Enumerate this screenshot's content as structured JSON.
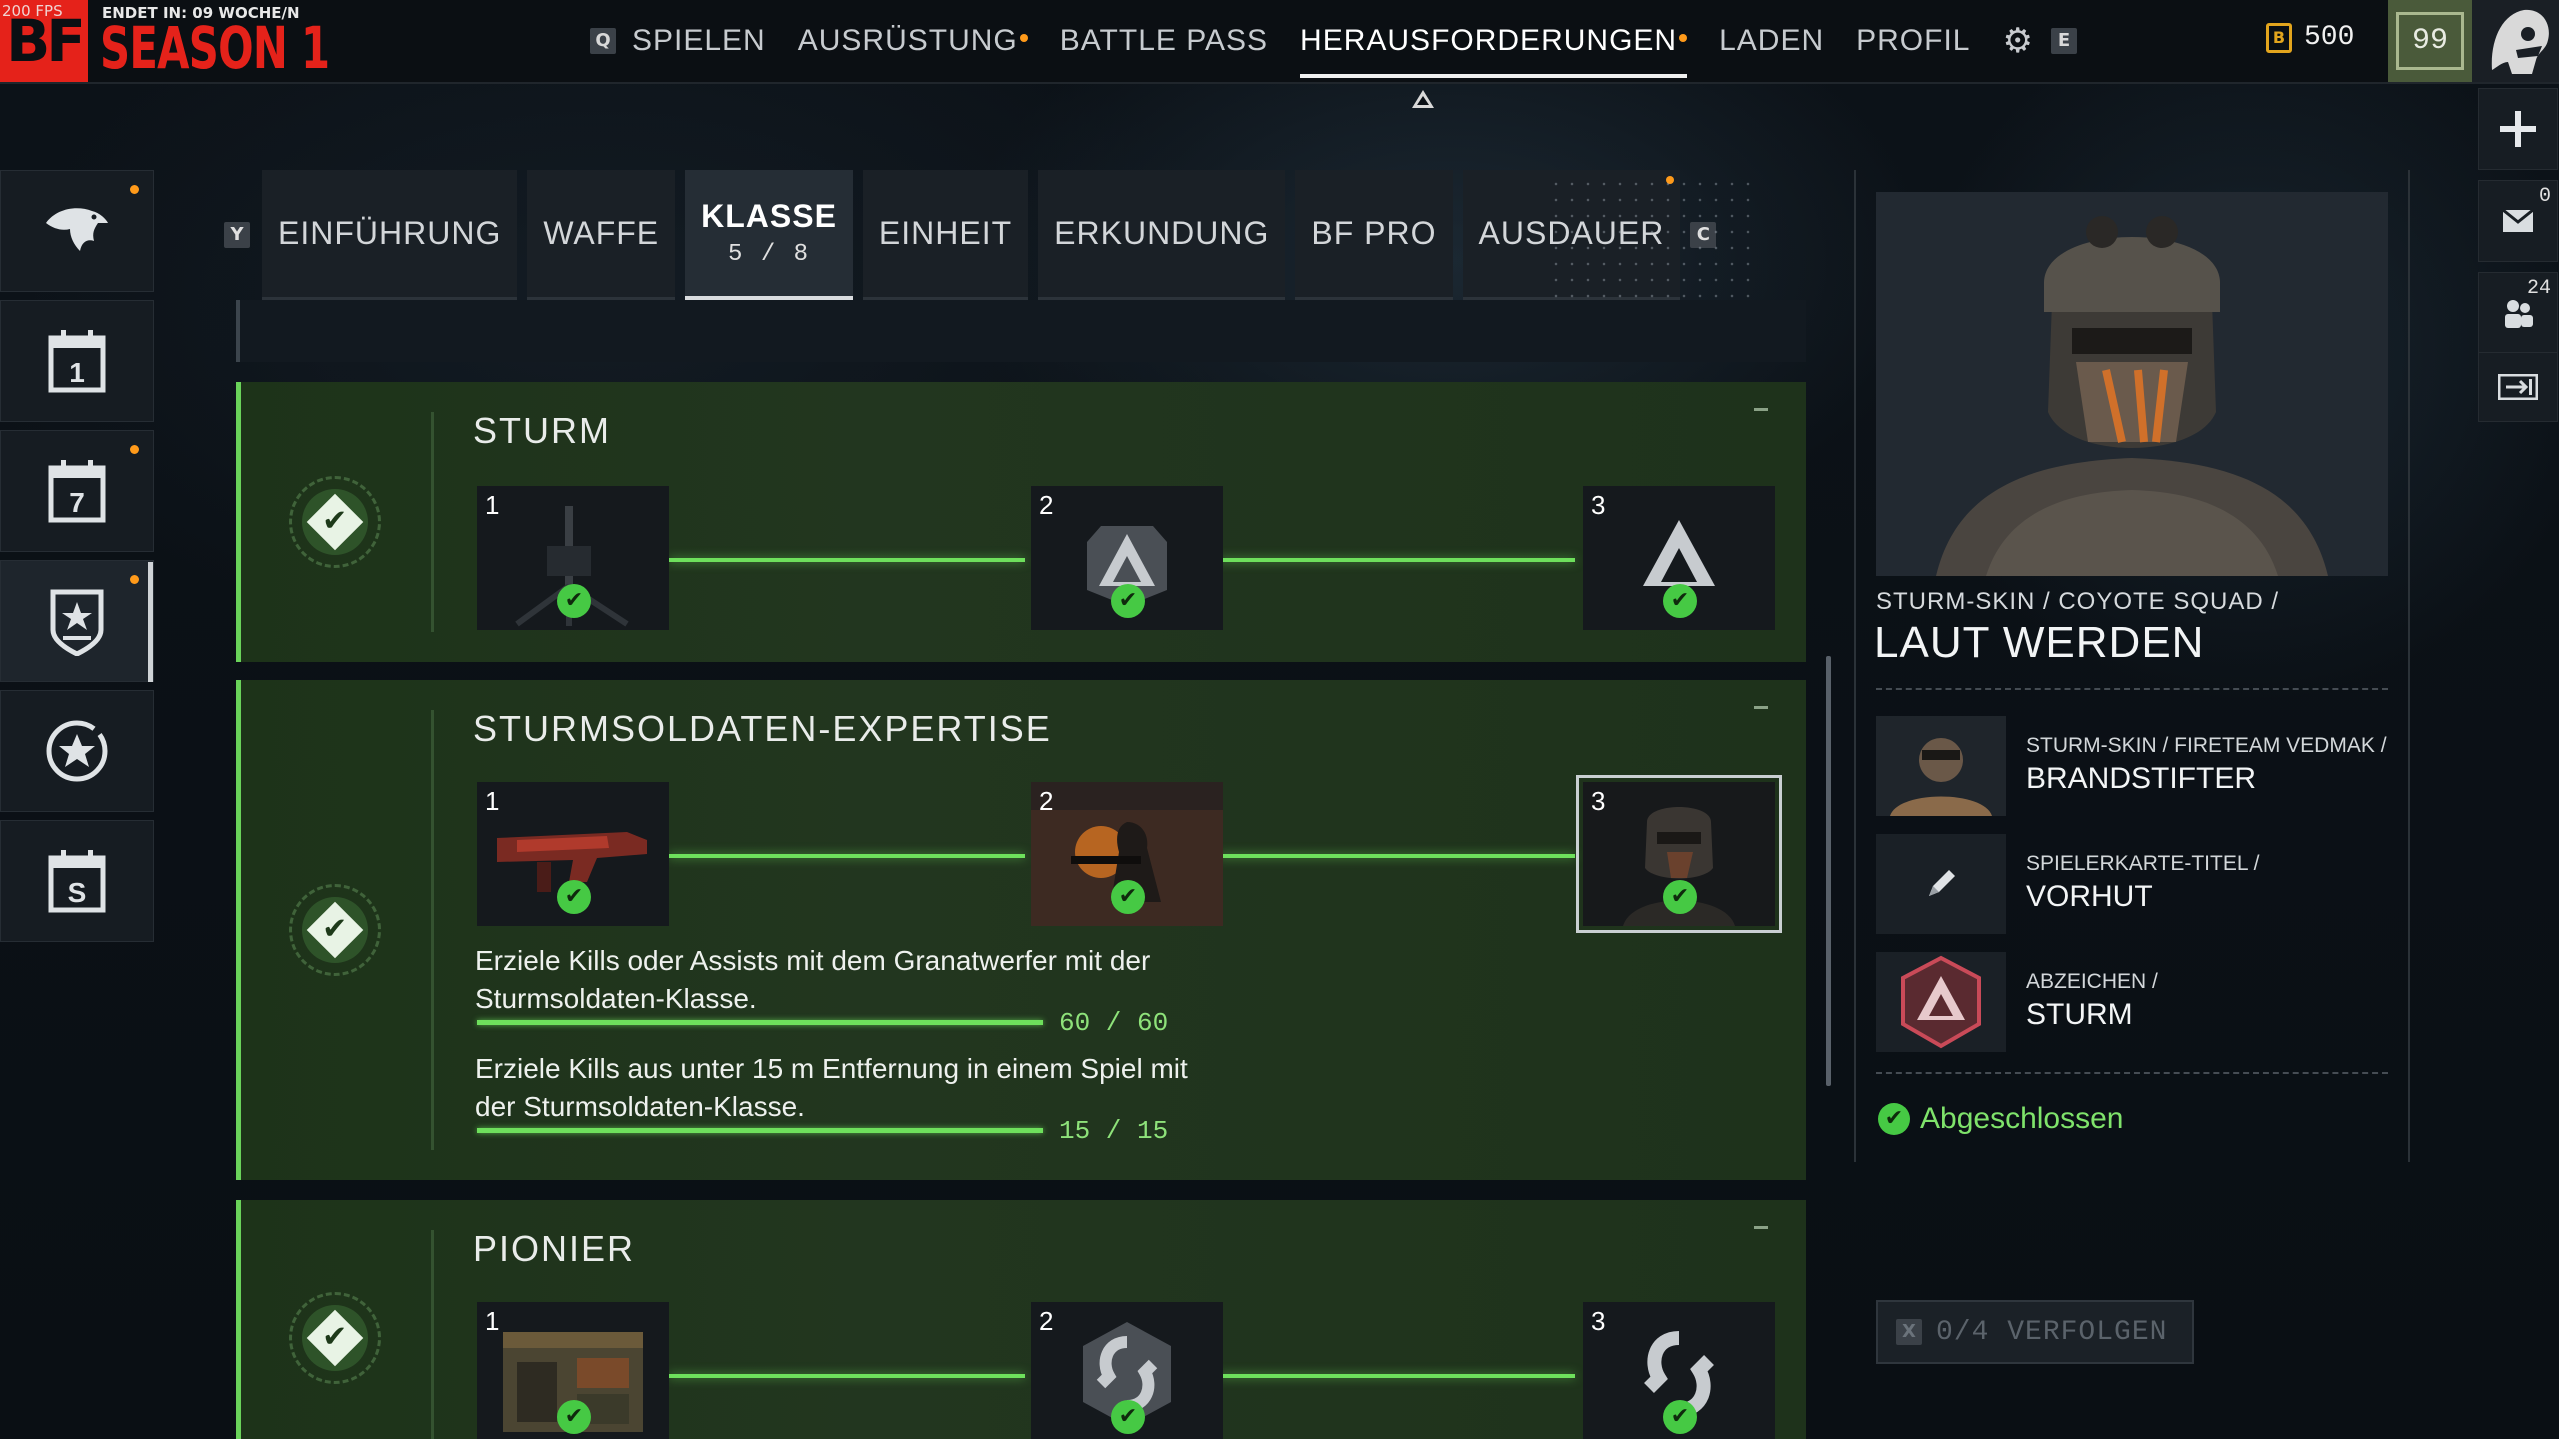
{
  "topbar": {
    "fps": "200 FPS",
    "logo": "BF",
    "ends_in": "ENDET IN: 09 WOCHE/N",
    "season": "SEASON 1",
    "nav_left_key": "Q",
    "nav_right_key": "E",
    "nav": [
      {
        "label": "SPIELEN",
        "dot": false,
        "active": false
      },
      {
        "label": "AUSRÜSTUNG",
        "dot": true,
        "active": false
      },
      {
        "label": "BATTLE PASS",
        "dot": false,
        "active": false
      },
      {
        "label": "HERAUSFORDERUNGEN",
        "dot": true,
        "active": true
      },
      {
        "label": "LADEN",
        "dot": false,
        "active": false
      },
      {
        "label": "PROFIL",
        "dot": false,
        "active": false
      }
    ],
    "currency_icon": "B",
    "currency_value": "500",
    "level": "99"
  },
  "right_util": {
    "mail_count": "0",
    "friends_count": "24"
  },
  "tabs": {
    "left_key": "Y",
    "right_key": "C",
    "items": [
      {
        "label": "EINFÜHRUNG"
      },
      {
        "label": "WAFFE"
      },
      {
        "label": "KLASSE",
        "progress": "5 / 8"
      },
      {
        "label": "EINHEIT"
      },
      {
        "label": "ERKUNDUNG"
      },
      {
        "label": "BF PRO"
      },
      {
        "label": "AUSDAUER"
      }
    ]
  },
  "challenges": [
    {
      "title": "STURM",
      "rewards": [
        "1",
        "2",
        "3"
      ]
    },
    {
      "title": "STURMSOLDATEN-EXPERTISE",
      "rewards": [
        "1",
        "2",
        "3"
      ],
      "tasks": [
        {
          "text": "Erziele Kills oder Assists mit dem Granatwerfer mit der Sturmsoldaten-Klasse.",
          "progress": "60 / 60",
          "fraction": 1.0
        },
        {
          "text": "Erziele Kills aus unter 15 m Entfernung in einem Spiel mit der Sturmsoldaten-Klasse.",
          "progress": "15 / 15",
          "fraction": 1.0
        }
      ]
    },
    {
      "title": "PIONIER",
      "rewards": [
        "1",
        "2",
        "3"
      ]
    }
  ],
  "detail": {
    "path": "STURM-SKIN / COYOTE SQUAD /",
    "name": "LAUT WERDEN",
    "sub_rewards": [
      {
        "path": "STURM-SKIN / FIRETEAM VEDMAK /",
        "name": "BRANDSTIFTER"
      },
      {
        "path": "SPIELERKARTE-TITEL /",
        "name": "VORHUT"
      },
      {
        "path": "ABZEICHEN /",
        "name": "STURM"
      }
    ],
    "status": "Abgeschlossen"
  },
  "track_button": {
    "key": "X",
    "label": "0/4 VERFOLGEN"
  },
  "colors": {
    "accent_green": "#6ee05c",
    "notify_orange": "#ff9a1a",
    "brand_red": "#e5221a",
    "currency_gold": "#e3a51d"
  }
}
